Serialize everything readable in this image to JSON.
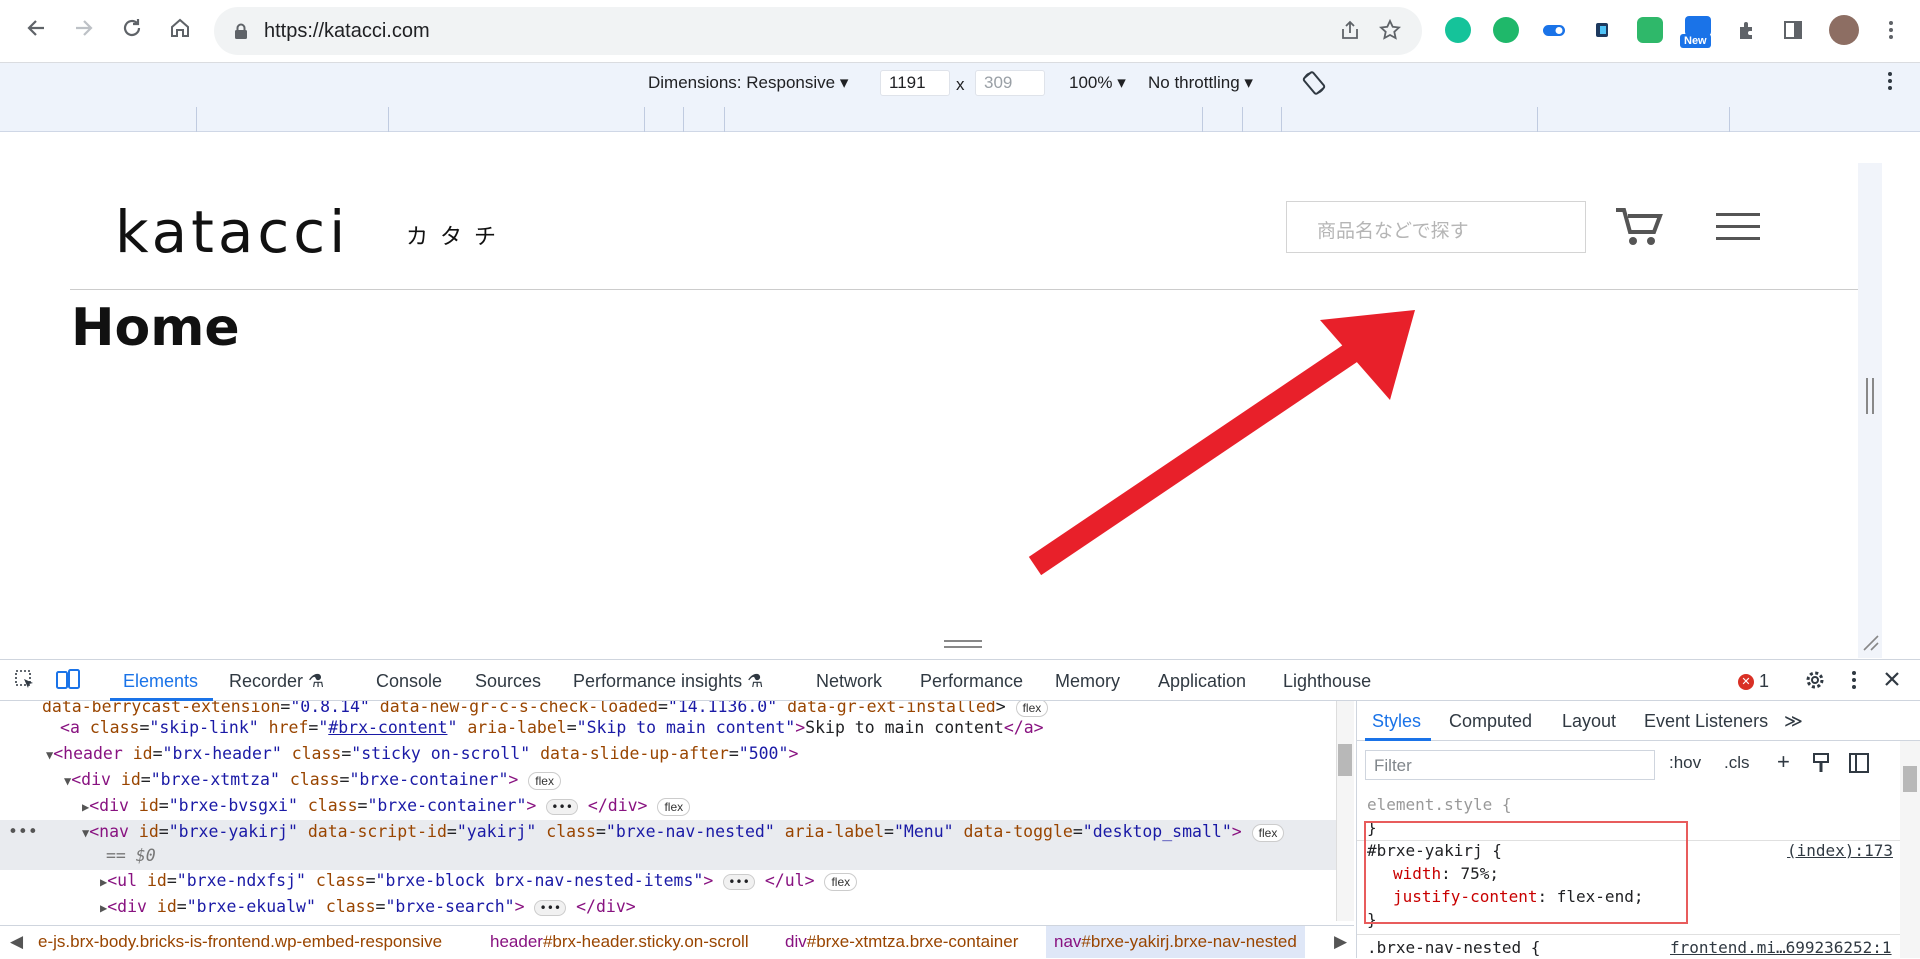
{
  "browser": {
    "url": "https://katacci.com",
    "new_badge": "New"
  },
  "device_toolbar": {
    "dimensions_label": "Dimensions: Responsive",
    "width": "1191",
    "times": "x",
    "height": "309",
    "zoom": "100%",
    "throttling": "No throttling"
  },
  "site": {
    "logo": "katacci",
    "logo_sub": "カタチ",
    "search_placeholder": "商品名などで探す",
    "page_title": "Home"
  },
  "devtools": {
    "tabs": [
      "Elements",
      "Recorder",
      "Console",
      "Sources",
      "Performance insights",
      "Network",
      "Performance",
      "Memory",
      "Application",
      "Lighthouse"
    ],
    "error_count": "1",
    "elements": {
      "line0": {
        "a1": "data-berrycast-extension",
        "v1": "0.8.14",
        "a2": "data-new-gr-c-s-check-loaded",
        "v2": "14.1136.0",
        "a3": "data-gr-ext-installed",
        "badge": "flex"
      },
      "line1": {
        "tag": "a",
        "a1": "class",
        "v1": "skip-link",
        "a2": "href",
        "v2": "#brx-content",
        "a3": "aria-label",
        "v3": "Skip to main content",
        "text": "Skip to main content"
      },
      "line2": {
        "tag": "header",
        "a1": "id",
        "v1": "brx-header",
        "a2": "class",
        "v2": "sticky on-scroll",
        "a3": "data-slide-up-after",
        "v3": "500"
      },
      "line3": {
        "tag": "div",
        "a1": "id",
        "v1": "brxe-xtmtza",
        "a2": "class",
        "v2": "brxe-container",
        "badge": "flex"
      },
      "line4": {
        "tag": "div",
        "a1": "id",
        "v1": "brxe-bvsgxi",
        "a2": "class",
        "v2": "brxe-container",
        "badge": "flex"
      },
      "line5": {
        "tag": "nav",
        "a1": "id",
        "v1": "brxe-yakirj",
        "a2": "data-script-id",
        "v2": "yakirj",
        "a3": "class",
        "v3": "brxe-nav-nested",
        "a4": "aria-label",
        "v4": "Menu",
        "a5": "data-toggle",
        "v5": "desktop_small",
        "badge": "flex"
      },
      "line6": {
        "comment": "== $0"
      },
      "line7": {
        "tag": "ul",
        "a1": "id",
        "v1": "brxe-ndxfsj",
        "a2": "class",
        "v2": "brxe-block brx-nav-nested-items",
        "badge": "flex"
      },
      "line8": {
        "tag": "div",
        "a1": "id",
        "v1": "brxe-ekualw",
        "a2": "class",
        "v2": "brxe-search"
      }
    },
    "breadcrumbs": [
      {
        "tag": "",
        "cls": "e-js.brx-body.bricks-is-frontend.wp-embed-responsive"
      },
      {
        "tag": "header",
        "cls": "#brx-header.sticky.on-scroll"
      },
      {
        "tag": "div",
        "cls": "#brxe-xtmtza.brxe-container"
      },
      {
        "tag": "nav",
        "cls": "#brxe-yakirj.brxe-nav-nested"
      }
    ],
    "styles_tabs": [
      "Styles",
      "Computed",
      "Layout",
      "Event Listeners"
    ],
    "filter_placeholder": "Filter",
    "hov": ":hov",
    "cls": ".cls",
    "rules": {
      "element_style": "element.style {",
      "close": "}",
      "selector": "#brxe-yakirj {",
      "source": "(index):173",
      "prop1": "width",
      "val1": "75%;",
      "prop2": "justify-content",
      "val2": "flex-end;",
      "next_selector": ".brxe-nav-nested {",
      "next_source": "frontend.mi…699236252:1"
    }
  }
}
